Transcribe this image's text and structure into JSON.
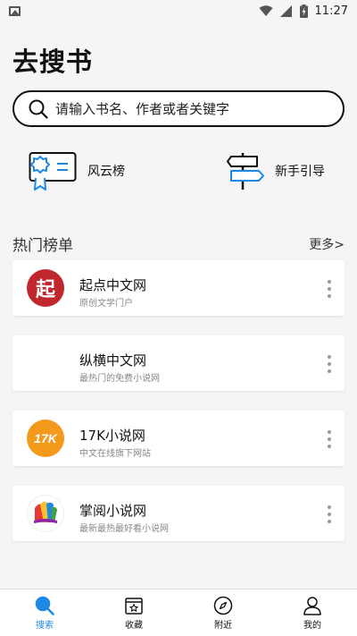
{
  "status_bar": {
    "time": "11:27",
    "icons": [
      "image-icon",
      "wifi-icon",
      "signal-icon",
      "battery-charging-icon"
    ]
  },
  "page": {
    "title": "去搜书"
  },
  "search": {
    "placeholder": "请输入书名、作者或者关键字"
  },
  "quick_links": [
    {
      "label": "风云榜",
      "icon": "certificate-icon"
    },
    {
      "label": "新手引导",
      "icon": "signpost-icon"
    }
  ],
  "hot_section": {
    "title": "热门榜单",
    "more_label": "更多>",
    "items": [
      {
        "name": "起点中文网",
        "desc": "原创文学门户",
        "logo_text": "起",
        "logo": "qidian-logo"
      },
      {
        "name": "纵横中文网",
        "desc": "最热门的免费小说网",
        "logo": "zongheng-logo"
      },
      {
        "name": "17K小说网",
        "desc": "中文在线旗下网站",
        "logo_text": "17K",
        "logo": "17k-logo"
      },
      {
        "name": "掌阅小说网",
        "desc": "最新最热最好看小说网",
        "logo": "zhangyue-logo"
      }
    ]
  },
  "bottom_nav": {
    "items": [
      {
        "label": "搜索",
        "icon": "search-icon",
        "active": true
      },
      {
        "label": "收藏",
        "icon": "bookshelf-icon"
      },
      {
        "label": "附近",
        "icon": "compass-icon"
      },
      {
        "label": "我的",
        "icon": "user-icon"
      }
    ]
  },
  "colors": {
    "accent": "#1e88e5",
    "background": "#f5f5f7",
    "qidian": "#c0282d",
    "k17": "#f39a1c"
  }
}
